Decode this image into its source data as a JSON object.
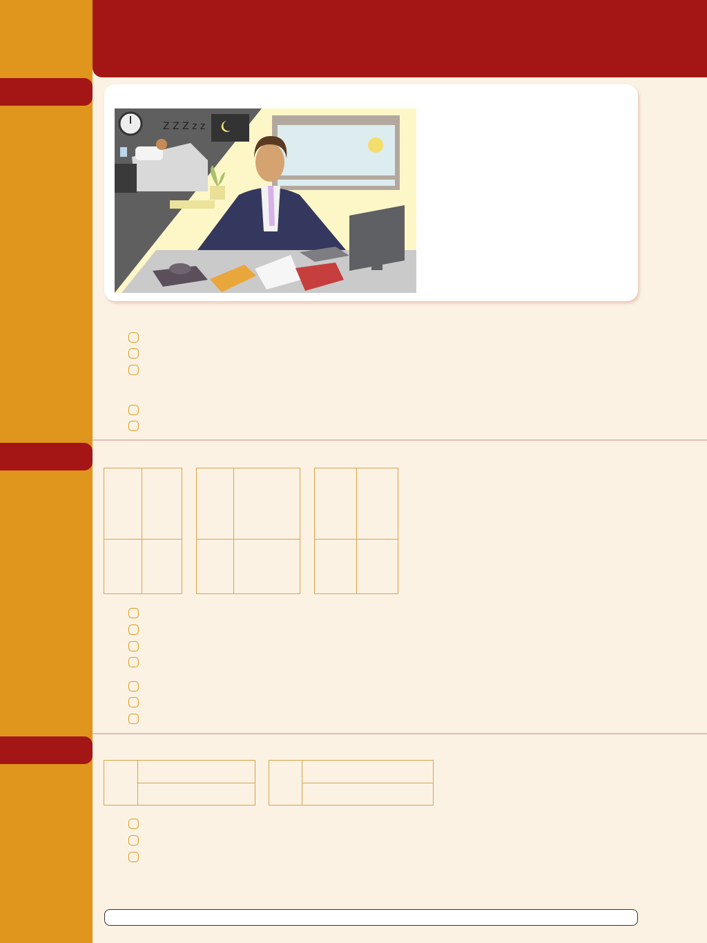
{
  "page": {
    "colors": {
      "header": "#a41616",
      "sidebar": "#e0951c",
      "background": "#fbf2e3",
      "grid_line": "#dca24a",
      "option_border": "#dc9a1e"
    }
  },
  "section1": {
    "illustration": {
      "icons": [
        "wall-clock-icon",
        "zzz-sleep-icon",
        "moon-icon",
        "sun-icon",
        "telephone-icon",
        "computer-monitor-icon"
      ]
    },
    "options_group1": [
      "",
      "",
      ""
    ],
    "options_group2": [
      "",
      ""
    ]
  },
  "section2": {
    "tables": [
      {
        "cells": [
          "",
          "",
          "",
          ""
        ]
      },
      {
        "cells": [
          "",
          "",
          "",
          ""
        ]
      },
      {
        "cells": [
          "",
          "",
          "",
          ""
        ]
      }
    ],
    "options_group1": [
      "",
      "",
      "",
      ""
    ],
    "options_group2": [
      "",
      "",
      ""
    ]
  },
  "section3": {
    "tables": [
      {
        "cells": [
          "",
          "",
          ""
        ]
      },
      {
        "cells": [
          "",
          "",
          ""
        ]
      }
    ],
    "options": [
      "",
      "",
      ""
    ]
  },
  "answer_bar": {
    "text": ""
  }
}
